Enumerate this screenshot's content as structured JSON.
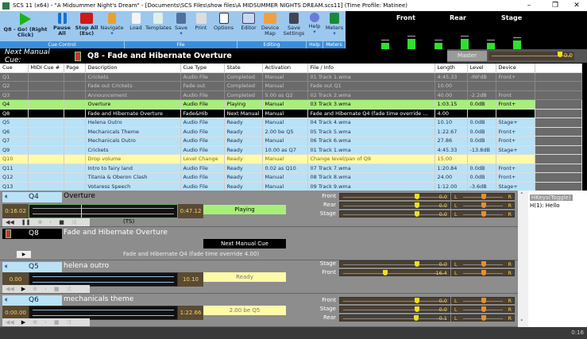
{
  "window": {
    "title": "SCS 11 (x64) - \"A Midsummer Night's Dream\" - [Documents\\SCS Files\\show files\\A MIDSUMMER NIGHTS DREAM.scs11] (Time Profile: Matinee)",
    "minimize": "–",
    "restore": "❐",
    "close": "✕"
  },
  "ribbon": {
    "go": "Q8 - Go! (Right Click)",
    "pause": "Pause All",
    "stop": "Stop All (Esc)",
    "navigate": "Navigate",
    "load": "Load",
    "templates": "Templates",
    "save": "Save",
    "print": "Print",
    "options": "Options",
    "editor": "Editor",
    "device_map": "Device Map",
    "save_settings": "Save Settings",
    "help": "Help",
    "meters": "Meters",
    "groups": {
      "cue_control": "Cue Control",
      "file": "File",
      "editing": "Editing",
      "help": "Help",
      "meters": "Meters"
    }
  },
  "meters": {
    "labels": [
      "Front",
      "Rear",
      "Stage"
    ],
    "levels": [
      0.45,
      0.75,
      0.45,
      0.75,
      0.45,
      0.65
    ]
  },
  "next_cue": {
    "label": "Next Manual Cue:",
    "value": "Q8 - Fade and Hibernate Overture"
  },
  "master": {
    "label": "Master",
    "value": "0.0",
    "level": 0.9
  },
  "table": {
    "headers": [
      "Cue",
      "MIDI Cue #",
      "Page",
      "Description",
      "Cue Type",
      "State",
      "Activation",
      "File / Info",
      "Length",
      "Level",
      "Device"
    ],
    "rows": [
      {
        "s": "completed",
        "c": [
          "Q1",
          "",
          "",
          "Crickets",
          "Audio File",
          "Completed",
          "Manual",
          "01 Track 1.wma",
          "4:45.33",
          "-INFdB",
          "Front+"
        ]
      },
      {
        "s": "completed",
        "c": [
          "Q2",
          "",
          "",
          "Fade out Crickets",
          "Fade out",
          "Completed",
          "Manual",
          "Fade out Q1",
          "10.00",
          "",
          ""
        ]
      },
      {
        "s": "completed",
        "c": [
          "Q3",
          "",
          "",
          "Announcement",
          "Audio File",
          "Completed",
          "5.00 as Q2",
          "02 Track 2.wma",
          "40.00",
          "-2.2dB",
          "Front"
        ]
      },
      {
        "s": "playing",
        "c": [
          "Q4",
          "",
          "",
          "Overture",
          "Audio File",
          "Playing",
          "Manual",
          "03 Track 3.wma",
          "1:03.15",
          "0.0dB",
          "Front+"
        ]
      },
      {
        "s": "next",
        "c": [
          "Q8",
          "",
          "",
          "Fade and Hibernate Overture",
          "Fade&Hib",
          "Next Manual",
          "Manual",
          "Fade and Hibernate Q4  (fade time override ...",
          "4.00",
          "",
          ""
        ]
      },
      {
        "s": "ready",
        "c": [
          "Q5",
          "",
          "",
          "Helena Outro",
          "Audio File",
          "Ready",
          "Manual",
          "04 Track 4.wma",
          "10.10",
          "0.0dB",
          "Stage+"
        ]
      },
      {
        "s": "ready",
        "c": [
          "Q6",
          "",
          "",
          "Mechanicals Theme",
          "Audio File",
          "Ready",
          "2.00 be Q5",
          "05 Track 5.wma",
          "1:22.67",
          "0.0dB",
          "Front+"
        ]
      },
      {
        "s": "ready",
        "c": [
          "Q7",
          "",
          "",
          "Mechanicals Outro",
          "Audio File",
          "Ready",
          "Manual",
          "06 Track 6.wma",
          "27.86",
          "0.0dB",
          "Front+"
        ]
      },
      {
        "s": "ready",
        "c": [
          "Q9",
          "",
          "",
          "Crickets",
          "Audio File",
          "Ready",
          "10.00 as Q7",
          "01 Track 1.wma",
          "4:45.33",
          "-13.8dB",
          "Stage+"
        ]
      },
      {
        "s": "level",
        "c": [
          "Q10",
          "",
          "",
          "Drop volume",
          "Level Change",
          "Ready",
          "Manual",
          "Change level/pan of Q9",
          "15.00",
          "",
          ""
        ]
      },
      {
        "s": "ready",
        "c": [
          "Q11",
          "",
          "",
          "Intro to fairy land",
          "Audio File",
          "Ready",
          "0.02 as Q10",
          "07 Track 7.wma",
          "1:20.84",
          "0.0dB",
          "Front+"
        ]
      },
      {
        "s": "ready",
        "c": [
          "Q12",
          "",
          "",
          "Titania & Oberon Clash",
          "Audio File",
          "Ready",
          "Manual",
          "08 Track 8.wma",
          "24.00",
          "0.0dB",
          "Front+"
        ]
      },
      {
        "s": "ready",
        "c": [
          "Q13",
          "",
          "",
          "Votaress Speech",
          "Audio File",
          "Ready",
          "Manual",
          "09 Track 9.wma",
          "1:12.00",
          "-3.6dB",
          "Stage+"
        ]
      }
    ]
  },
  "panels": {
    "q4": {
      "cue": "Q4",
      "desc": "Overture",
      "start": "0:16.02",
      "end": "0:47.12",
      "state": "Playing",
      "ts": "(TS)",
      "progress": 0.33,
      "faders": [
        {
          "dev": "Front",
          "db": "0.0",
          "lvl": 0.9
        },
        {
          "dev": "Rear",
          "db": "0.0",
          "lvl": 0.9
        },
        {
          "dev": "Stage",
          "db": "0.0",
          "lvl": 0.9
        }
      ]
    },
    "q8": {
      "cue": "Q8",
      "desc": "Fade and Hibernate Overture",
      "state": "Next Manual Cue",
      "info": "Fade and Hibernate Q4  (fade time override 4.00)"
    },
    "q5": {
      "cue": "Q5",
      "desc": "helena outro",
      "start": "0.00",
      "end": "10.10",
      "state": "Ready",
      "faders": [
        {
          "dev": "Stage",
          "db": "0.0",
          "lvl": 0.9
        },
        {
          "dev": "Front",
          "db": "-16.4",
          "lvl": 0.5
        }
      ]
    },
    "q6": {
      "cue": "Q6",
      "desc": "mechanicals theme",
      "start": "0:00.00",
      "end": "1:22.66",
      "state": "2.00 be Q5",
      "faders": [
        {
          "dev": "Front",
          "db": "0.0",
          "lvl": 0.9
        },
        {
          "dev": "Stage",
          "db": "0.0",
          "lvl": 0.9
        },
        {
          "dev": "Rear",
          "db": "-0.1",
          "lvl": 0.89
        }
      ]
    },
    "pan": {
      "l": "L",
      "r": "R"
    }
  },
  "hkeys": {
    "header": "HKeys(Toggle)",
    "items": [
      "H(1): Hello"
    ]
  },
  "status": {
    "time": "0:16"
  }
}
